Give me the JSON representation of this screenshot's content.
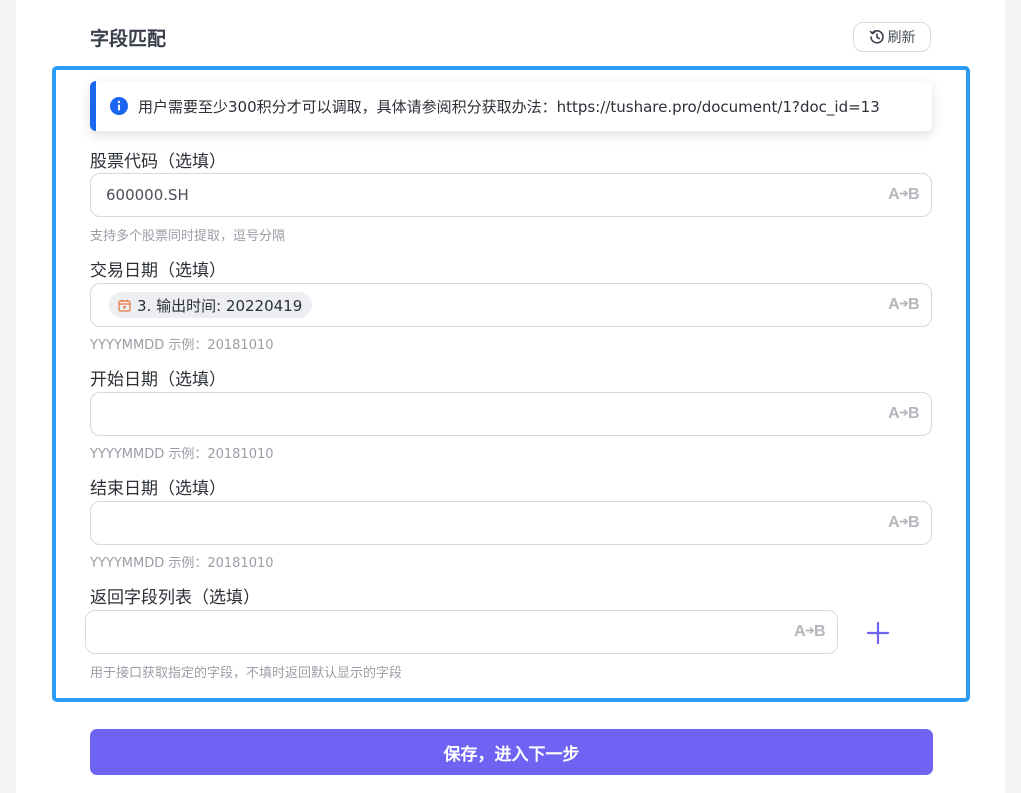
{
  "header": {
    "title": "字段匹配",
    "refresh_label": "刷新"
  },
  "info_banner": {
    "text": "用户需要至少300积分才可以调取，具体请参阅积分获取办法：https://tushare.pro/document/1?doc_id=13"
  },
  "fields": {
    "stock_code": {
      "label": "股票代码（选填）",
      "value": "600000.SH",
      "hint": "支持多个股票同时提取，逗号分隔"
    },
    "trade_date": {
      "label": "交易日期（选填）",
      "chip_label": "3. 输出时间: 20220419",
      "hint": "YYYYMMDD 示例：20181010"
    },
    "start_date": {
      "label": "开始日期（选填）",
      "value": "",
      "hint": "YYYYMMDD 示例：20181010"
    },
    "end_date": {
      "label": "结束日期（选填）",
      "value": "",
      "hint": "YYYYMMDD 示例：20181010"
    },
    "return_fields": {
      "label": "返回字段列表（选填）",
      "value": "",
      "hint": "用于接口获取指定的字段，不填时返回默认显示的字段"
    }
  },
  "ab_icon_text": "A➔B",
  "save_button_label": "保存，进入下一步",
  "colors": {
    "accent": "#6e63f3",
    "frame_border": "#2a9cf6",
    "info_blue": "#1a66f0",
    "chip_icon": "#e8743b"
  },
  "icons": {
    "refresh": "history-icon",
    "info": "info-icon",
    "variable_mapping": "a-to-b-icon",
    "calendar": "calendar-icon",
    "add": "plus-icon"
  }
}
